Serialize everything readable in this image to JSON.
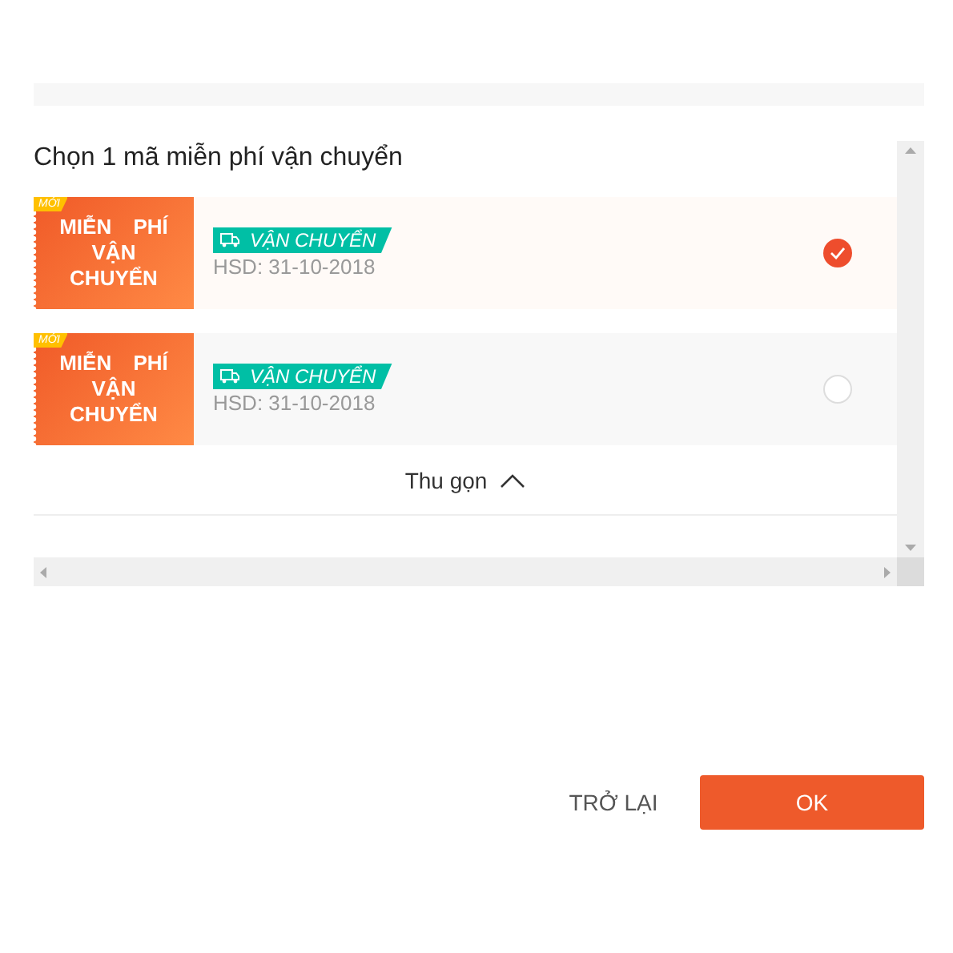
{
  "title": "Chọn 1 mã miễn phí vận chuyển",
  "vouchers": [
    {
      "badge": "MỚI",
      "label": "MIỄN PHÍ VẬN CHUYỂN",
      "tag": "VẬN CHUYỂN",
      "expiry": "HSD: 31-10-2018",
      "selected": true
    },
    {
      "badge": "MỚI",
      "label": "MIỄN PHÍ VẬN CHUYỂN",
      "tag": "VẬN CHUYỂN",
      "expiry": "HSD: 31-10-2018",
      "selected": false
    }
  ],
  "collapse": "Thu gọn",
  "buttons": {
    "back": "TRỞ LẠI",
    "ok": "OK"
  }
}
